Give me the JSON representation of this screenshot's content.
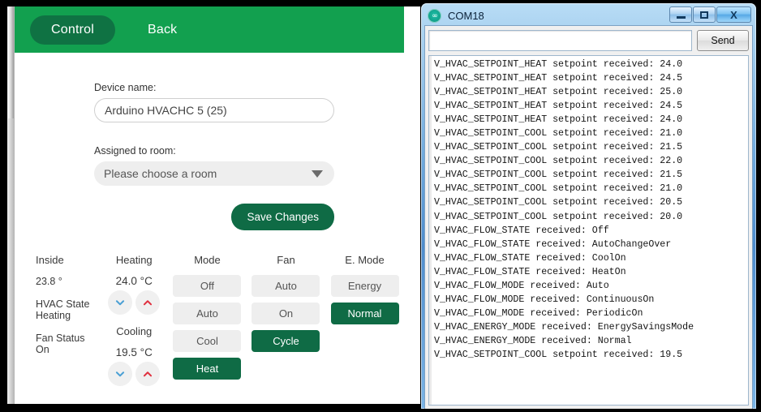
{
  "app": {
    "header": {
      "tabs": [
        {
          "label": "Control",
          "active": true
        },
        {
          "label": "Back",
          "active": false
        }
      ],
      "bg_color": "#12a04f",
      "active_tab_color": "#0f7243"
    },
    "form": {
      "device_name_label": "Device name:",
      "device_name_value": "Arduino HVACHC 5 (25)",
      "assigned_room_label": "Assigned to room:",
      "assigned_room_value": "Please choose a room",
      "assigned_room_is_placeholder": true,
      "save_button_label": "Save Changes",
      "save_button_color": "#0f6b45"
    },
    "status": {
      "inside_label": "Inside",
      "inside_value": "23.8 °",
      "hvac_state_label": "HVAC State",
      "hvac_state_value": "Heating",
      "fan_status_label": "Fan Status",
      "fan_status_value": "On"
    },
    "setpoints": {
      "heating_label": "Heating",
      "heating_value": "24.0 °C",
      "cooling_label": "Cooling",
      "cooling_value": "19.5 °C",
      "down_icon": "chevron-down-icon",
      "up_icon": "chevron-up-icon",
      "down_color": "#4a9fd4",
      "up_color": "#e0303f"
    },
    "mode": {
      "label": "Mode",
      "options": [
        {
          "label": "Off",
          "selected": false
        },
        {
          "label": "Auto",
          "selected": false
        },
        {
          "label": "Cool",
          "selected": false
        },
        {
          "label": "Heat",
          "selected": true
        }
      ]
    },
    "fan": {
      "label": "Fan",
      "options": [
        {
          "label": "Auto",
          "selected": false
        },
        {
          "label": "On",
          "selected": false
        },
        {
          "label": "Cycle",
          "selected": true
        }
      ]
    },
    "emode": {
      "label": "E. Mode",
      "options": [
        {
          "label": "Energy",
          "selected": false
        },
        {
          "label": "Normal",
          "selected": true
        }
      ]
    }
  },
  "serial_monitor": {
    "title": "COM18",
    "logo_icon": "arduino-logo-icon",
    "window_buttons": {
      "minimize": "minimize-icon",
      "maximize": "maximize-icon",
      "close": "X"
    },
    "send_input_value": "",
    "send_button_label": "Send",
    "log_lines": [
      "V_HVAC_SETPOINT_HEAT setpoint received: 24.0",
      "V_HVAC_SETPOINT_HEAT setpoint received: 24.5",
      "V_HVAC_SETPOINT_HEAT setpoint received: 25.0",
      "V_HVAC_SETPOINT_HEAT setpoint received: 24.5",
      "V_HVAC_SETPOINT_HEAT setpoint received: 24.0",
      "V_HVAC_SETPOINT_COOL setpoint received: 21.0",
      "V_HVAC_SETPOINT_COOL setpoint received: 21.5",
      "V_HVAC_SETPOINT_COOL setpoint received: 22.0",
      "V_HVAC_SETPOINT_COOL setpoint received: 21.5",
      "V_HVAC_SETPOINT_COOL setpoint received: 21.0",
      "V_HVAC_SETPOINT_COOL setpoint received: 20.5",
      "V_HVAC_SETPOINT_COOL setpoint received: 20.0",
      "V_HVAC_FLOW_STATE received: Off",
      "V_HVAC_FLOW_STATE received: AutoChangeOver",
      "V_HVAC_FLOW_STATE received: CoolOn",
      "V_HVAC_FLOW_STATE received: HeatOn",
      "V_HVAC_FLOW_MODE received: Auto",
      "V_HVAC_FLOW_MODE received: ContinuousOn",
      "V_HVAC_FLOW_MODE received: PeriodicOn",
      "V_HVAC_ENERGY_MODE received: EnergySavingsMode",
      "V_HVAC_ENERGY_MODE received: Normal",
      "V_HVAC_SETPOINT_COOL setpoint received: 19.5"
    ]
  }
}
